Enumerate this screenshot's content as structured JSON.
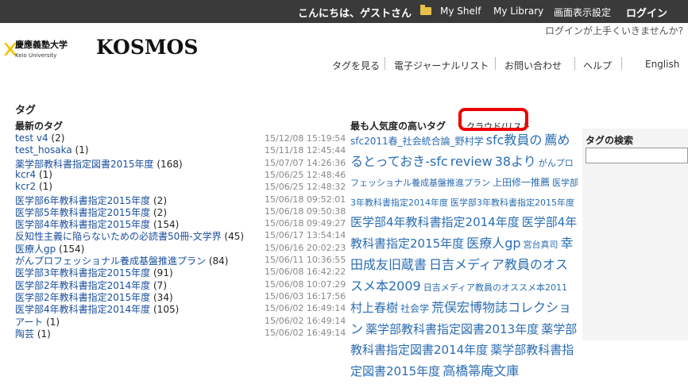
{
  "topbar": {
    "greeting": "こんにちは、ゲストさん",
    "my_shelf": "My Shelf",
    "my_library": "My Library",
    "display_settings": "画面表示設定",
    "login": "ログイン"
  },
  "login_help": "ログインが上手くいきませんか?",
  "logo": {
    "jp": "慶應義塾大学",
    "en": "Keio University",
    "name": "KOSMOS"
  },
  "nav": {
    "tags": "タグを見る",
    "ejournals": "電子ジャーナルリスト",
    "contact": "お問い合わせ",
    "help": "ヘルプ",
    "english": "English"
  },
  "page_title": "タグ",
  "latest_tags_title": "最新のタグ",
  "popular_tags_title": "最も人気度の高いタグ",
  "cloud_list_tab": "クラウド/リスト",
  "search_title": "タグの検索",
  "latest_tags": [
    {
      "name": "test v4",
      "count": "(2)",
      "date": "15/12/08 15:19:54"
    },
    {
      "name": "test_hosaka",
      "count": "(1)",
      "date": "15/11/18 12:45:44"
    },
    {
      "name": "薬学部教科書指定図書2015年度",
      "count": "(168)",
      "date": "15/07/07 14:26:36"
    },
    {
      "name": "kcr4",
      "count": "(1)",
      "date": "15/06/25 12:48:46"
    },
    {
      "name": "kcr2",
      "count": "(1)",
      "date": "15/06/25 12:48:32"
    },
    {
      "name": "医学部6年教科書指定2015年度",
      "count": "(2)",
      "date": "15/06/18 09:52:01"
    },
    {
      "name": "医学部5年教科書指定2015年度",
      "count": "(2)",
      "date": "15/06/18 09:50:38"
    },
    {
      "name": "医学部4年教科書指定2015年度",
      "count": "(154)",
      "date": "15/06/18 09:49:27"
    },
    {
      "name": "反知性主義に陥らないための必読書50冊-文学界",
      "count": "(45)",
      "date": "15/06/17 13:54:14"
    },
    {
      "name": "医療人gp",
      "count": "(154)",
      "date": "15/06/16 20:02:23"
    },
    {
      "name": "がんプロフェッショナル養成基盤推進プラン",
      "count": "(84)",
      "date": "15/06/11 10:36:55"
    },
    {
      "name": "医学部3年教科書指定2015年度",
      "count": "(91)",
      "date": "15/06/08 16:42:22"
    },
    {
      "name": "医学部2年教科書指定2014年度",
      "count": "(7)",
      "date": "15/06/08 10:07:29"
    },
    {
      "name": "医学部2年教科書指定2015年度",
      "count": "(34)",
      "date": "15/06/03 16:17:56"
    },
    {
      "name": "医学部4年教科書指定2014年度",
      "count": "(105)",
      "date": "15/06/02 16:49:14"
    },
    {
      "name": "アート",
      "count": "(1)",
      "date": "15/06/02 16:49:14"
    },
    {
      "name": "陶芸",
      "count": "(1)",
      "date": "15/06/02 16:49:14"
    }
  ],
  "cloud_tags": [
    {
      "name": "sfc2011春_社会統合論_野村学",
      "size": 12
    },
    {
      "name": "sfc教員の",
      "size": 16
    },
    {
      "name": "薦めるとっておき-sfc",
      "size": 16
    },
    {
      "name": "review",
      "size": 16
    },
    {
      "name": "38より",
      "size": 16
    },
    {
      "name": "がんプロフェッショナル養成基盤推進プラン",
      "size": 11
    },
    {
      "name": "上田修一推薦",
      "size": 12
    },
    {
      "name": "医学部3年教科書指定2014年度",
      "size": 11
    },
    {
      "name": "医学部3年教科書指定2015年度",
      "size": 11
    },
    {
      "name": "医学部4年教科書指定2014年度",
      "size": 15
    },
    {
      "name": "医学部4年教科書指定2015年度",
      "size": 15
    },
    {
      "name": "医療人gp",
      "size": 16
    },
    {
      "name": "宮台真司",
      "size": 11
    },
    {
      "name": "幸田成友旧蔵書",
      "size": 16
    },
    {
      "name": "日吉メディア教員のオススメ本2009",
      "size": 16
    },
    {
      "name": "日吉メディア教員のオススメ本2011",
      "size": 11
    },
    {
      "name": "村上春樹",
      "size": 15
    },
    {
      "name": "社会学",
      "size": 12
    },
    {
      "name": "荒俣宏博物誌コレクション",
      "size": 16
    },
    {
      "name": "薬学部教科書指定図書2013年度",
      "size": 15
    },
    {
      "name": "薬学部教科書指定図書2014年度",
      "size": 15
    },
    {
      "name": "薬学部教科書指定図書2015年度",
      "size": 15
    },
    {
      "name": "高橋箒庵文庫",
      "size": 16
    }
  ],
  "colors": {
    "topbar_bg": "#3a3a3a",
    "link": "#1a4f9c",
    "cloud_link": "#2b6db2",
    "highlight": "#e00000"
  }
}
